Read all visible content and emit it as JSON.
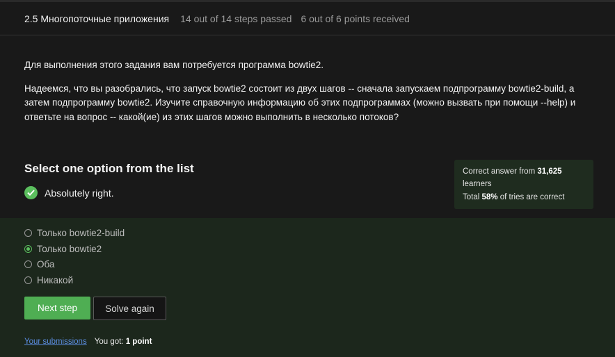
{
  "header": {
    "lesson_title": "2.5 Многопоточные приложения",
    "steps_status": "14 out of 14 steps passed",
    "points_status": "6 out of 6 points  received"
  },
  "task": {
    "paragraph1": "Для выполнения этого задания вам потребуется программа bowtie2.",
    "paragraph2": "Надеемся, что вы разобрались, что запуск bowtie2 состоит из двух шагов -- сначала запускаем подпрограмму bowtie2-build, а затем подпрограмму bowtie2. Изучите справочную информацию об этих подпрограммах (можно вызвать при помощи --help) и ответьте на вопрос -- какой(ие) из этих шагов можно выполнить в несколько потоков?"
  },
  "feedback": {
    "title": "Select one option from the list",
    "status": "Absolutely right.",
    "check_color": "#5bbf5e"
  },
  "stats": {
    "correct_prefix": "Correct answer from ",
    "learners_count": "31,625",
    "learners_suffix": "learners",
    "total_prefix": "Total ",
    "percent": "58%",
    "total_suffix": " of tries are correct"
  },
  "options": [
    {
      "label": "Только bowtie2-build",
      "selected": false
    },
    {
      "label": "Только bowtie2",
      "selected": true
    },
    {
      "label": "Оба",
      "selected": false
    },
    {
      "label": "Никакой",
      "selected": false
    }
  ],
  "buttons": {
    "next_step": "Next step",
    "solve_again": "Solve again"
  },
  "footer": {
    "submissions_link": "Your submissions",
    "got_prefix": "You got: ",
    "got_value": "1 point"
  },
  "colors": {
    "accent_green": "#4fae53",
    "link_blue": "#5b8de0",
    "options_bg": "#1c271c"
  }
}
